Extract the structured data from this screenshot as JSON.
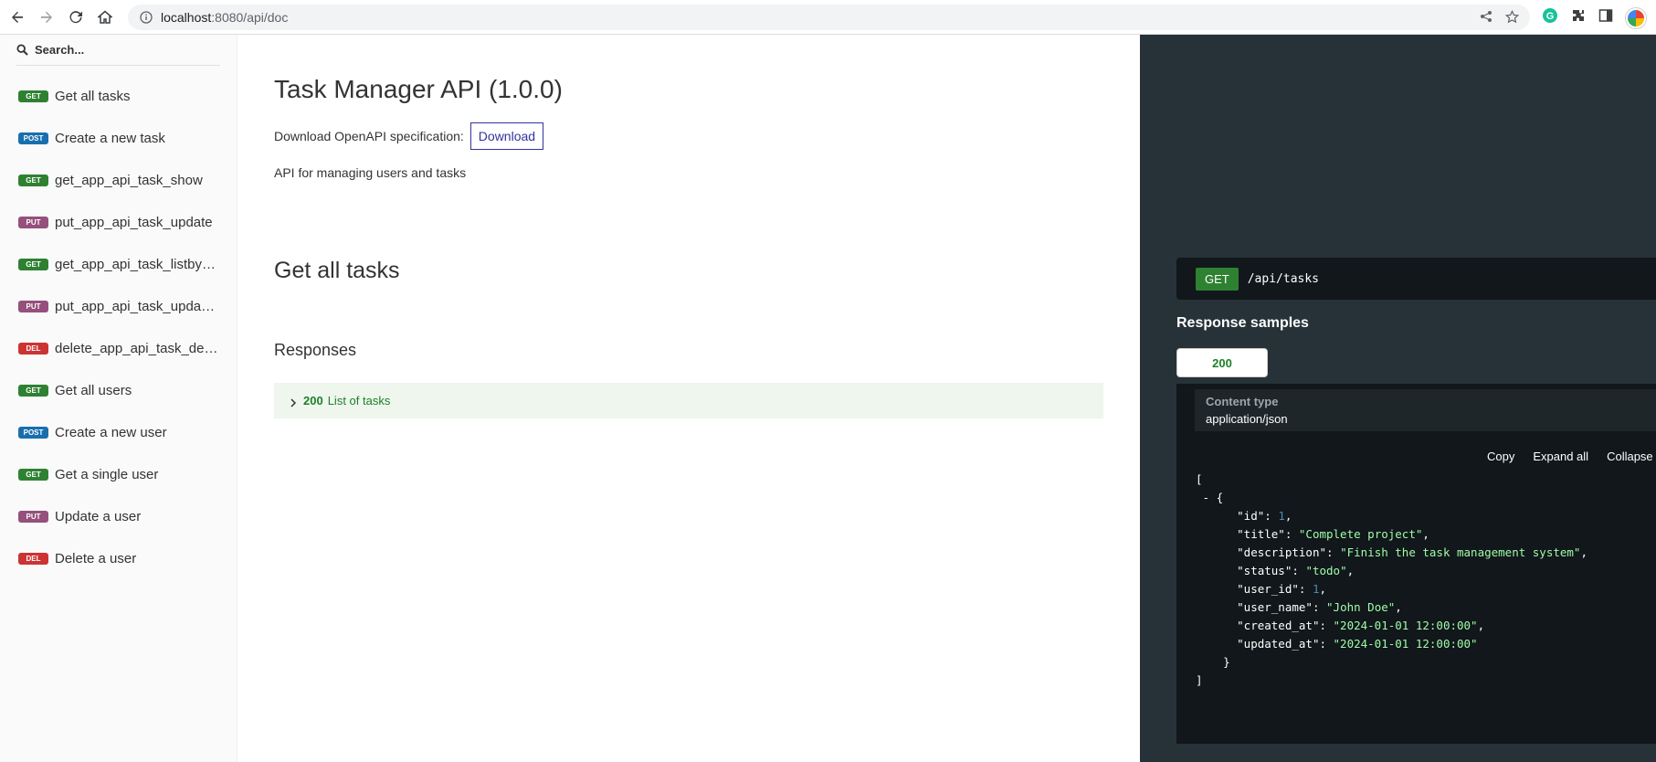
{
  "browser": {
    "url_host": "localhost",
    "url_rest": ":8080/api/doc"
  },
  "sidebar": {
    "search_placeholder": "Search...",
    "items": [
      {
        "method": "GET",
        "cls": "get",
        "label": "Get all tasks"
      },
      {
        "method": "POST",
        "cls": "post",
        "label": "Create a new task"
      },
      {
        "method": "GET",
        "cls": "get",
        "label": "get_app_api_task_show"
      },
      {
        "method": "PUT",
        "cls": "put",
        "label": "put_app_api_task_update"
      },
      {
        "method": "GET",
        "cls": "get",
        "label": "get_app_api_task_listby…"
      },
      {
        "method": "PUT",
        "cls": "put",
        "label": "put_app_api_task_upda…"
      },
      {
        "method": "DEL",
        "cls": "del",
        "label": "delete_app_api_task_del…"
      },
      {
        "method": "GET",
        "cls": "get",
        "label": "Get all users"
      },
      {
        "method": "POST",
        "cls": "post",
        "label": "Create a new user"
      },
      {
        "method": "GET",
        "cls": "get",
        "label": "Get a single user"
      },
      {
        "method": "PUT",
        "cls": "put",
        "label": "Update a user"
      },
      {
        "method": "DEL",
        "cls": "del",
        "label": "Delete a user"
      }
    ]
  },
  "main": {
    "title": "Task Manager API (1.0.0)",
    "download_text": "Download OpenAPI specification:",
    "download_label": "Download",
    "description": "API for managing users and tasks",
    "operation_title": "Get all tasks",
    "responses_title": "Responses",
    "response_code": "200",
    "response_desc": "List of tasks"
  },
  "right": {
    "method": "GET",
    "path": "/api/tasks",
    "samples_title": "Response samples",
    "tab_label": "200",
    "content_type_label": "Content type",
    "content_type_value": "application/json",
    "controls": {
      "copy": "Copy",
      "expand": "Expand all",
      "collapse": "Collapse all"
    },
    "json_fields": [
      {
        "key": "\"id\"",
        "value": "1",
        "type": "num",
        "comma": true
      },
      {
        "key": "\"title\"",
        "value": "\"Complete project\"",
        "type": "str",
        "comma": true
      },
      {
        "key": "\"description\"",
        "value": "\"Finish the task management system\"",
        "type": "str",
        "comma": true
      },
      {
        "key": "\"status\"",
        "value": "\"todo\"",
        "type": "str",
        "comma": true
      },
      {
        "key": "\"user_id\"",
        "value": "1",
        "type": "num",
        "comma": true
      },
      {
        "key": "\"user_name\"",
        "value": "\"John Doe\"",
        "type": "str",
        "comma": true
      },
      {
        "key": "\"created_at\"",
        "value": "\"2024-01-01 12:00:00\"",
        "type": "str",
        "comma": true
      },
      {
        "key": "\"updated_at\"",
        "value": "\"2024-01-01 12:00:00\"",
        "type": "str",
        "comma": false
      }
    ]
  }
}
